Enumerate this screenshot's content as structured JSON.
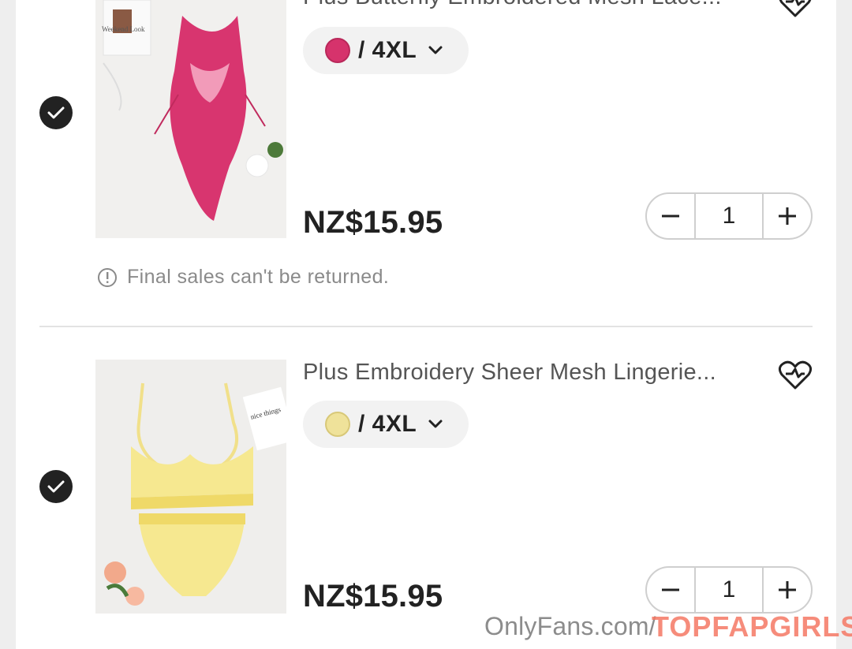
{
  "items": [
    {
      "title": "Plus Butterfly Embroidered Mesh Lace...",
      "variant": "/ 4XL",
      "swatch_color": "#d6336c",
      "price": "NZ$15.95",
      "quantity": "1",
      "selected": true,
      "notice": "Final sales can't be returned."
    },
    {
      "title": "Plus Embroidery Sheer Mesh Lingerie...",
      "variant": "/ 4XL",
      "swatch_color": "#efe29a",
      "price": "NZ$15.95",
      "quantity": "1",
      "selected": true
    }
  ],
  "stepper": {
    "minus": "−",
    "plus": "+"
  },
  "watermark": {
    "text": "OnlyFans.com/",
    "brand": "TOPFAPGIRLS"
  },
  "colors": {
    "check_bg": "#222222",
    "text_dark": "#222222",
    "text_muted": "#8a8a8a",
    "border": "#cfcfcf"
  }
}
